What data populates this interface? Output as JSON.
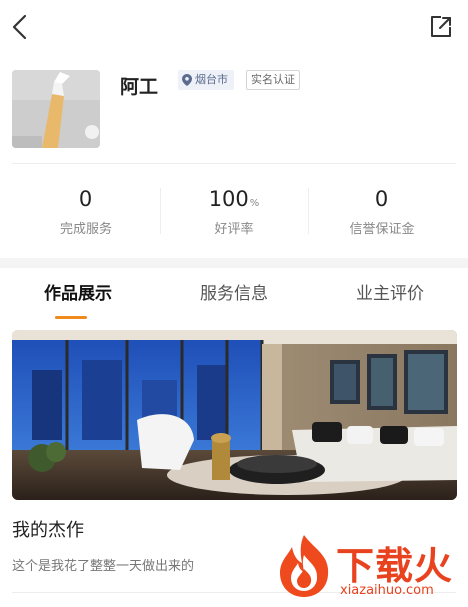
{
  "header": {
    "back_icon": "chevron-left-icon",
    "share_icon": "share-external-icon"
  },
  "profile": {
    "name": "阿工",
    "location": "烟台市",
    "location_icon": "map-pin-icon",
    "verify_badge": "实名认证"
  },
  "stats": [
    {
      "value": "0",
      "unit": "",
      "label": "完成服务"
    },
    {
      "value": "100",
      "unit": "%",
      "label": "好评率"
    },
    {
      "value": "0",
      "unit": "",
      "label": "信誉保证金"
    }
  ],
  "tabs": [
    {
      "label": "作品展示",
      "active": true
    },
    {
      "label": "服务信息",
      "active": false
    },
    {
      "label": "业主评价",
      "active": false
    }
  ],
  "work": {
    "title": "我的杰作",
    "description": "这个是我花了整整一天做出来的"
  },
  "watermark": {
    "text": "下载火",
    "url": "xiazaihuo.com"
  },
  "colors": {
    "accent": "#f08a1c",
    "watermark": "#e8421f",
    "badge_bg": "#eef1f7"
  }
}
